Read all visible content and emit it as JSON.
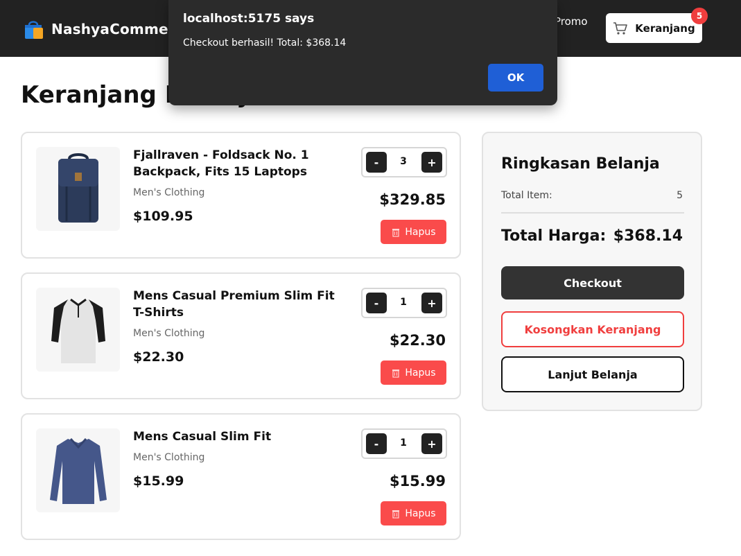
{
  "header": {
    "brand": "NashyaCommerce",
    "nav_promo": "Promo",
    "cart_label": "Keranjang",
    "cart_count": "5"
  },
  "page": {
    "title": "Keranjang Belanja"
  },
  "items": [
    {
      "title": "Fjallraven - Foldsack No. 1 Backpack, Fits 15 Laptops",
      "category": "Men's Clothing",
      "price": "$109.95",
      "qty": "3",
      "subtotal": "$329.85",
      "minus": "-",
      "plus": "+",
      "remove": "Hapus",
      "image_icon": "backpack-icon"
    },
    {
      "title": "Mens Casual Premium Slim Fit T-Shirts",
      "category": "Men's Clothing",
      "price": "$22.30",
      "qty": "1",
      "subtotal": "$22.30",
      "minus": "-",
      "plus": "+",
      "remove": "Hapus",
      "image_icon": "raglan-shirt-icon"
    },
    {
      "title": "Mens Casual Slim Fit",
      "category": "Men's Clothing",
      "price": "$15.99",
      "qty": "1",
      "subtotal": "$15.99",
      "minus": "-",
      "plus": "+",
      "remove": "Hapus",
      "image_icon": "long-sleeve-shirt-icon"
    }
  ],
  "summary": {
    "title": "Ringkasan Belanja",
    "total_items_label": "Total Item:",
    "total_items_value": "5",
    "total_price_label": "Total Harga:",
    "total_price_value": "$368.14",
    "checkout": "Checkout",
    "empty_cart": "Kosongkan Keranjang",
    "continue_shopping": "Lanjut Belanja"
  },
  "dialog": {
    "title": "localhost:5175 says",
    "message": "Checkout berhasil! Total: $368.14",
    "ok": "OK"
  },
  "colors": {
    "header_bg": "#222222",
    "accent_red": "#fa4b4b",
    "dialog_bg": "#2b2b2b",
    "dialog_button": "#1f5fd6"
  }
}
